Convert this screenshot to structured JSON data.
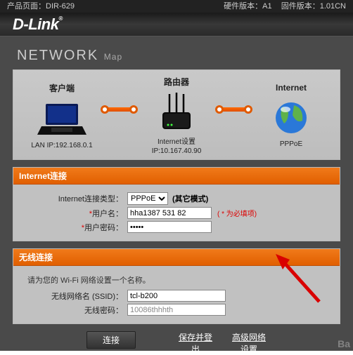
{
  "topbar": {
    "product_label": "产品页面：DIR-629",
    "hw_label": "硬件版本：A1",
    "fw_label": "固件版本：1.01CN"
  },
  "logo": "D-Link",
  "title": {
    "main": "NETWORK",
    "sub": "Map"
  },
  "map": {
    "client": {
      "title": "客户端",
      "line1": "LAN IP:192.168.0.1"
    },
    "router": {
      "title": "路由器",
      "line1": "Internet设置",
      "line2": "IP:10.167.40.90"
    },
    "internet": {
      "title": "Internet",
      "line1": "PPPoE"
    }
  },
  "internet_section": {
    "header": "Internet连接",
    "type_label": "Internet连接类型：",
    "type_value": "PPPoE",
    "mode_note": "(其它模式)",
    "user_label": "用户名：",
    "user_value": "hha1387 531 82",
    "required_note": "( * 为必填项)",
    "pass_label": "用户密码：",
    "pass_value": "•••••"
  },
  "wifi_section": {
    "header": "无线连接",
    "hint": "请为您的 Wi-Fi 网络设置一个名称。",
    "ssid_label": "无线网络名 (SSID)：",
    "ssid_value": "tcl-b200",
    "pw_label": "无线密码：",
    "pw_value": "10086thhhth"
  },
  "buttons": {
    "connect": "连接",
    "save": "保存并登出",
    "advanced": "高级网络设置"
  }
}
